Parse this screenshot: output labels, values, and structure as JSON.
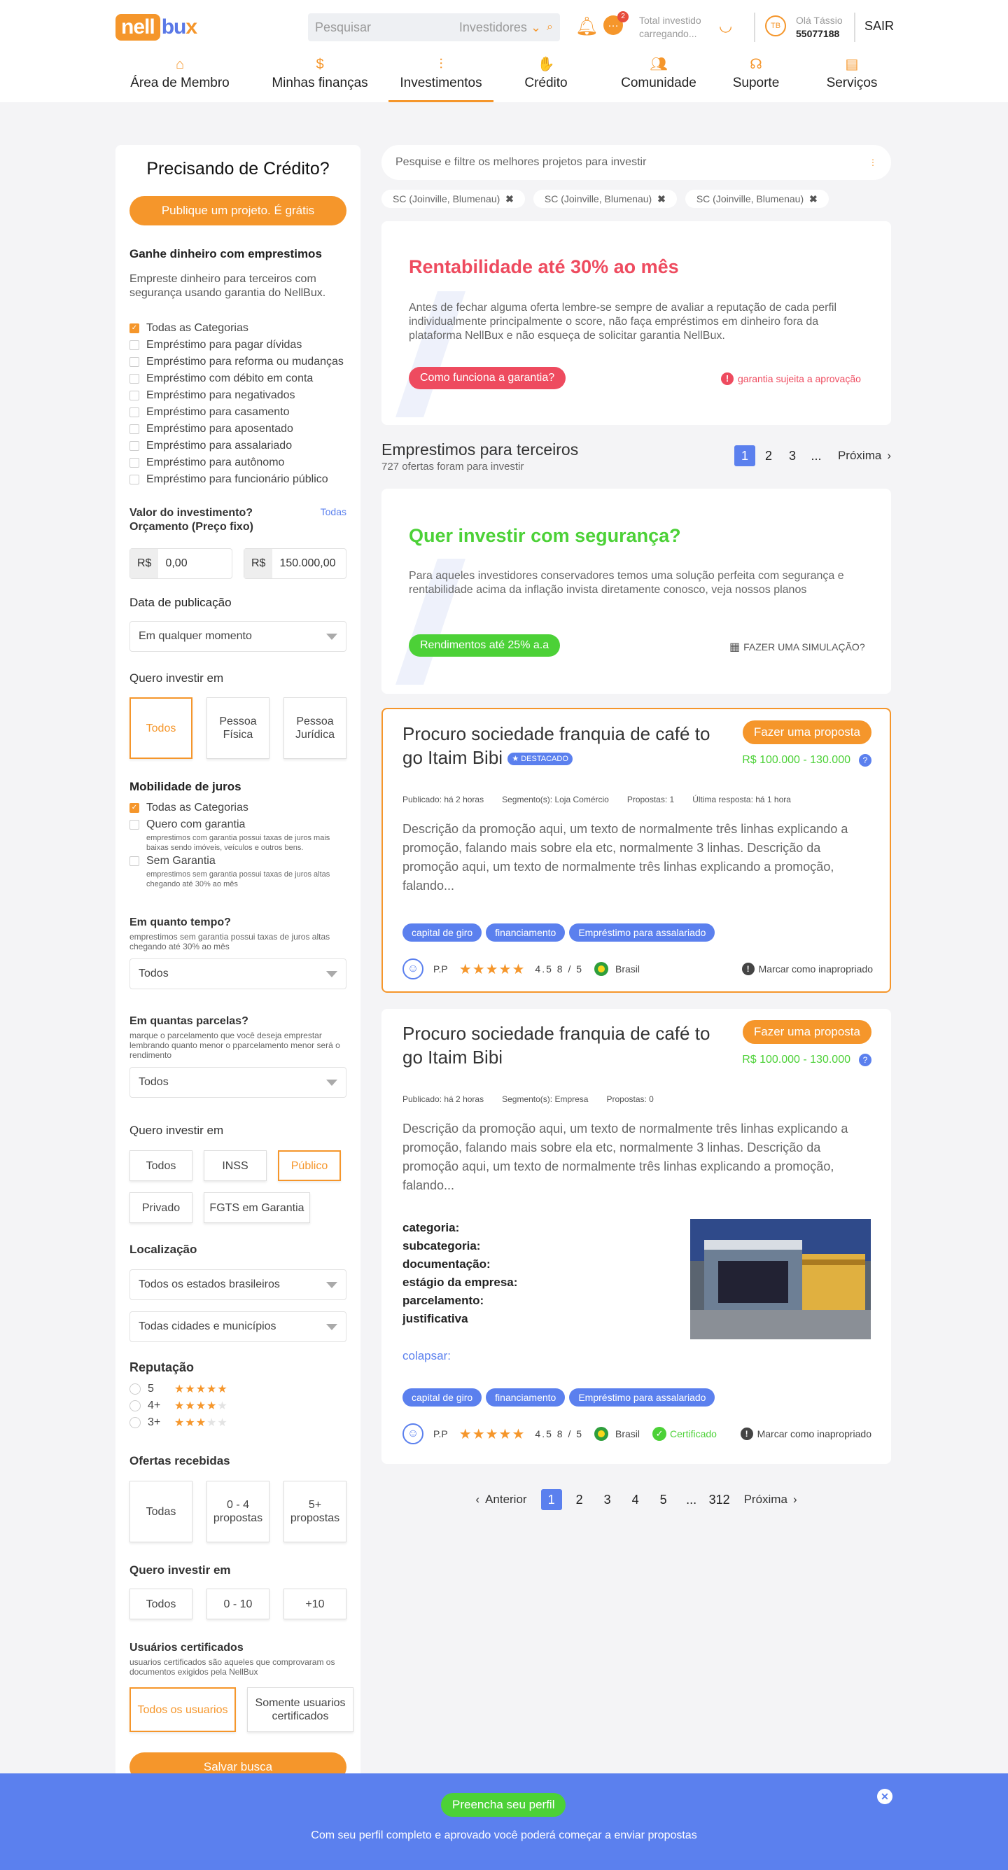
{
  "header": {
    "logo_nell": "nell",
    "logo_bux": "bu",
    "logo_x": "x",
    "search_placeholder": "Pesquisar",
    "search_select": "Investidores",
    "chat_badge": "2",
    "invest_label": "Total investido",
    "invest_value": "carregando...",
    "avatar": "TB",
    "greeting": "Olá Tássio",
    "user_id": "55077188",
    "logout": "SAIR"
  },
  "nav": [
    {
      "label": "Área de Membro",
      "icon": "home-icon"
    },
    {
      "label": "Minhas finanças",
      "icon": "money-bag-icon"
    },
    {
      "label": "Investimentos",
      "icon": "growth-icon"
    },
    {
      "label": "Crédito",
      "icon": "hand-coin-icon"
    },
    {
      "label": "Comunidade",
      "icon": "people-icon"
    },
    {
      "label": "Suporte",
      "icon": "headset-icon"
    },
    {
      "label": "Serviços",
      "icon": "document-icon"
    }
  ],
  "sidebar": {
    "title": "Precisando de Crédito?",
    "publish": "Publique um projeto. É grátis",
    "earn_title": "Ganhe dinheiro com emprestimos",
    "earn_desc": "Empreste dinheiro para terceiros com segurança usando garantia do NellBux.",
    "categories": [
      "Todas as Categorias",
      "Empréstimo para pagar dívidas",
      "Empréstimo para reforma ou mudanças",
      "Empréstimo com débito em conta",
      "Empréstimo para negativados",
      "Empréstimo para casamento",
      "Empréstimo para aposentado",
      "Empréstimo para assalariado",
      "Empréstimo para autônomo",
      "Empréstimo para funcionário público"
    ],
    "value_title": "Valor do investimento?",
    "value_sub": "Orçamento (Preço fixo)",
    "value_all": "Todas",
    "currency": "R$",
    "min": "0,00",
    "max": "150.000,00",
    "date_title": "Data de publicação",
    "date_value": "Em qualquer momento",
    "invest_in_title": "Quero investir em",
    "invest_in": [
      "Todos",
      "Pessoa Física",
      "Pessoa Jurídica"
    ],
    "mob_title": "Mobilidade de juros",
    "mob_all": "Todas as Categorias",
    "mob_with": "Quero com garantia",
    "mob_with_desc": "emprestimos com garantia possui taxas de juros mais baixas sendo imóveis, veículos e outros bens.",
    "mob_without": "Sem Garantia",
    "mob_without_desc": "emprestimos sem garantia possui taxas de juros altas chegando até 30% ao mês",
    "time_title": "Em quanto tempo?",
    "time_desc": "emprestimos sem garantia possui taxas de juros altas chegando até 30% ao mês",
    "time_value": "Todos",
    "parc_title": "Em quantas parcelas?",
    "parc_desc": "marque o parcelamento que você deseja emprestar lembrando quanto menor o pparcelamento menor será o rendimento",
    "parc_value": "Todos",
    "invest2_title": "Quero investir em",
    "invest2": [
      "Todos",
      "INSS",
      "Público",
      "Privado",
      "FGTS em Garantia"
    ],
    "loc_title": "Localização",
    "loc_state": "Todos os estados brasileiros",
    "loc_city": "Todas cidades e municípios",
    "rep_title": "Reputação",
    "rep": [
      "5",
      "4+",
      "3+"
    ],
    "offers_title": "Ofertas recebidas",
    "offers": [
      "Todas",
      "0 - 4 propostas",
      "5+ propostas"
    ],
    "invest3_title": "Quero investir em",
    "invest3": [
      "Todos",
      "0 - 10",
      "+10"
    ],
    "cert_title": "Usuários certificados",
    "cert_desc": "usuarios certificados são aqueles que comprovaram os documentos exigidos pela NellBux",
    "cert": [
      "Todos os usuarios",
      "Somente usuarios certificados"
    ],
    "save": "Salvar busca"
  },
  "main": {
    "search_placeholder": "Pesquise e filtre os melhores projetos para investir",
    "chips": [
      "SC (Joinville, Blumenau)",
      "SC (Joinville, Blumenau)",
      "SC (Joinville, Blumenau)"
    ],
    "promo1": {
      "title": "Rentabilidade até 30% ao mês",
      "text": "Antes de fechar alguma oferta lembre-se sempre de avaliar a reputação de cada perfil individualmente principalmente o score, não faça empréstimos em dinheiro fora da plataforma NellBux e não esqueça de solicitar garantia NellBux.",
      "button": "Como funciona a garantia?",
      "note": "garantia sujeita a aprovação",
      "color": "#ee4b5f"
    },
    "list_title": "Emprestimos para terceiros",
    "list_sub": "727 ofertas foram para investir",
    "top_pages": [
      "1",
      "2",
      "3",
      "..."
    ],
    "next": "Próxima",
    "promo2": {
      "title": "Quer investir com segurança?",
      "text": "Para aqueles investidores conservadores temos uma solução perfeita com segurança e rentabilidade acima da inflação invista diretamente conosco, veja nossos planos",
      "button": "Rendimentos até 25% a.a",
      "link": "FAZER UMA SIMULAÇÃO?",
      "color": "#4cd137"
    },
    "offer1": {
      "title": "Procuro sociedade franquia de café to go Itaim Bibi",
      "badge": "DESTACADO",
      "proposal": "Fazer uma proposta",
      "range": "R$ 100.000 - 130.000",
      "published": "Publicado: há 2 horas",
      "segment": "Segmento(s): Loja Comércio",
      "proposals": "Propostas: 1",
      "last": "Última resposta:  há 1 hora",
      "desc": "Descrição da promoção aqui, um texto de normalmente  três linhas explicando a promoção, falando mais sobre ela etc, normalmente 3 linhas. Descrição da promoção aqui, um texto de normalmente  três linhas explicando a promoção, falando...",
      "tags": [
        "capital de giro",
        "financiamento",
        "Empréstimo para assalariado"
      ],
      "user": "P.P",
      "rating": "4.5 8 / 5",
      "country": "Brasil",
      "report": "Marcar como inapropriado"
    },
    "offer2": {
      "title": "Procuro sociedade franquia de café to go Itaim Bibi",
      "proposal": "Fazer uma proposta",
      "range": "R$ 100.000 - 130.000",
      "published": "Publicado: há 2 horas",
      "segment": "Segmento(s): Empresa",
      "proposals": "Propostas: 0",
      "desc": "Descrição da promoção aqui, um texto de normalmente  três linhas explicando a promoção, falando mais sobre ela etc, normalmente 3 linhas. Descrição da promoção aqui, um texto de normalmente  três linhas explicando a promoção, falando...",
      "fields": [
        "categoria:",
        "subcategoria:",
        "documentação:",
        "estágio da empresa:",
        "parcelamento:",
        "justificativa"
      ],
      "collapse": "colapsar:",
      "tags": [
        "capital de giro",
        "financiamento",
        "Empréstimo para assalariado"
      ],
      "user": "P.P",
      "rating": "4.5 8 / 5",
      "country": "Brasil",
      "certified": "Certificado",
      "report": "Marcar como inapropriado"
    },
    "bottom_pages": [
      "1",
      "2",
      "3",
      "4",
      "5",
      "...",
      "312"
    ],
    "prev": "Anterior"
  },
  "footer": {
    "button": "Preencha seu perfil",
    "text": "Com seu perfil completo e aprovado você poderá começar a enviar propostas"
  },
  "colors": {
    "accent": "#f5962b",
    "blue": "#5b80ee",
    "green": "#4cd137",
    "red": "#ee4b5f"
  }
}
